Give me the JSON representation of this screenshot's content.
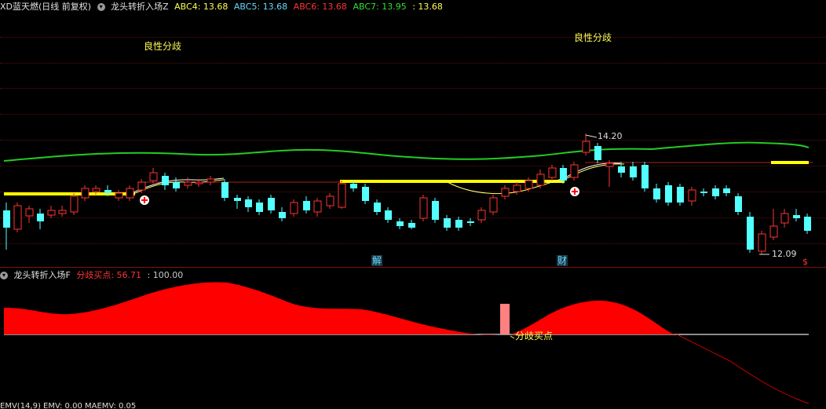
{
  "main": {
    "stock": "XD蓝天燃(日线 前复权)",
    "indicator": "龙头转折入场Z",
    "series": [
      {
        "label": "ABC4: 13.68",
        "color": "#ffff55"
      },
      {
        "label": "ABC5: 13.68",
        "color": "#66d9ff"
      },
      {
        "label": "ABC6: 13.68",
        "color": "#ff3333"
      },
      {
        "label": "ABC7: 13.95",
        "color": "#33dd33"
      },
      {
        "label": ": 13.68",
        "color": "#ffff55"
      }
    ],
    "annotations": {
      "divergence_left": "良性分歧",
      "divergence_right": "良性分歧",
      "high_price": "14.20",
      "low_price": "12.09",
      "marker_jie": "解",
      "marker_cai": "财",
      "marker_s": "$"
    }
  },
  "sub": {
    "indicator": "龙头转折入场F",
    "series": [
      {
        "label": "分歧买点: 56.71",
        "color": "#ff3333"
      },
      {
        "label": ": 100.00",
        "color": "#c8c8c8"
      }
    ],
    "buy_point_label": "分歧买点"
  },
  "bottom": {
    "text": "EMV(14,9) EMV: 0.00 MAEMV: 0.05"
  },
  "colors": {
    "up": "#ff3333",
    "down": "#54ffff",
    "band": "#22cc22",
    "thick": "#ffff00",
    "fill": "#ff0000"
  }
}
